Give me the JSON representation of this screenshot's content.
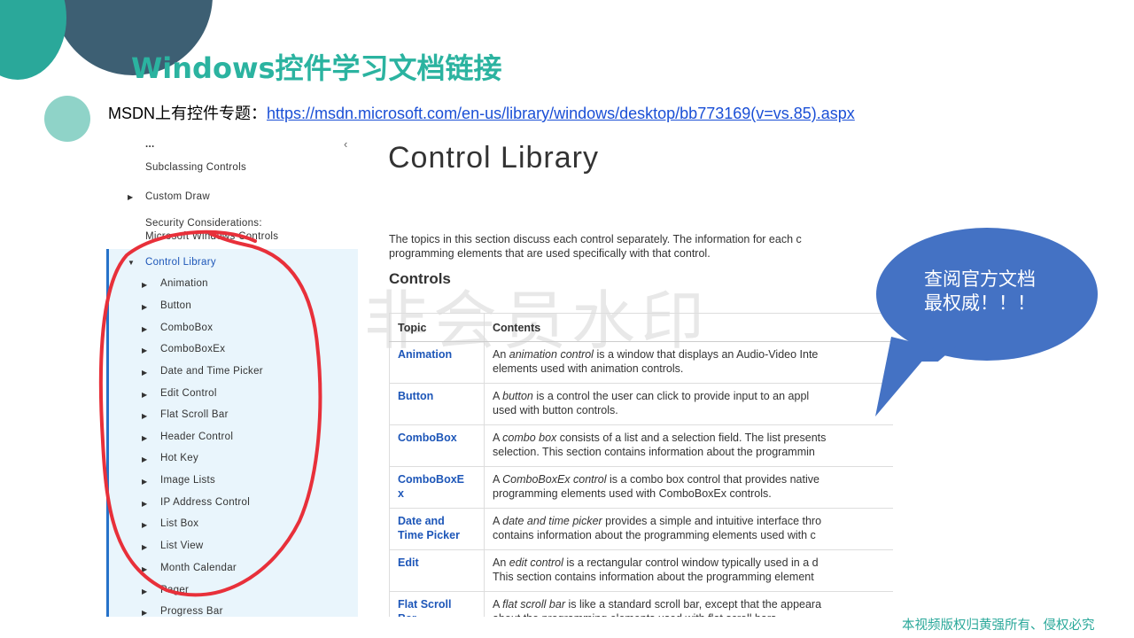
{
  "slide": {
    "title": "Windows控件学习文档链接",
    "msdn_prefix": "MSDN上有控件专题：",
    "msdn_link": "https://msdn.microsoft.com/en-us/library/windows/desktop/bb773169(v=vs.85).aspx",
    "footer": "本视频版权归黄强所有、侵权必究",
    "bubble_line1": "查阅官方文档",
    "bubble_line2": "最权威！！！",
    "colors": {
      "title": "#2bb3a0",
      "bubble": "#4472c4",
      "loop": "#e8303a",
      "link": "#1a4fd6"
    }
  },
  "sidebar": {
    "ellipsis": "...",
    "collapse_icon": "chevron-left-icon",
    "items": [
      {
        "label": "Subclassing Controls"
      },
      {
        "label": "Custom Draw"
      },
      {
        "label": "Security Considerations:"
      },
      {
        "label": "Microsoft Windows Controls"
      },
      {
        "label": "Control Library"
      },
      {
        "label": "Animation"
      },
      {
        "label": "Button"
      },
      {
        "label": "ComboBox"
      },
      {
        "label": "ComboBoxEx"
      },
      {
        "label": "Date and Time Picker"
      },
      {
        "label": "Edit Control"
      },
      {
        "label": "Flat Scroll Bar"
      },
      {
        "label": "Header Control"
      },
      {
        "label": "Hot Key"
      },
      {
        "label": "Image Lists"
      },
      {
        "label": "IP Address Control"
      },
      {
        "label": "List Box"
      },
      {
        "label": "List View"
      },
      {
        "label": "Month Calendar"
      },
      {
        "label": "Pager"
      },
      {
        "label": "Progress Bar"
      }
    ]
  },
  "content": {
    "heading": "Control Library",
    "intro_line1": "The topics in this section discuss each control separately. The information for each c",
    "intro_line2": "programming elements that are used specifically with that control.",
    "controls_heading": "Controls",
    "watermark": "非会员水印",
    "table": {
      "headers": [
        "Topic",
        "Contents"
      ],
      "rows": [
        {
          "topic1": "Animation",
          "topic2": "",
          "pre": "An ",
          "em": "animation control",
          "post": " is a window that displays an Audio-Video Inte",
          "line2": "elements used with animation controls."
        },
        {
          "topic1": "Button",
          "topic2": "",
          "pre": "A ",
          "em": "button",
          "post": " is a control the user can click to provide input to an appl",
          "line2": "used with button controls."
        },
        {
          "topic1": "ComboBox",
          "topic2": "",
          "pre": "A ",
          "em": "combo box",
          "post": " consists of a list and a selection field. The list presents",
          "line2": "selection. This section contains information about the programmin"
        },
        {
          "topic1": "ComboBoxE",
          "topic2": "x",
          "pre": "A ",
          "em": "ComboBoxEx control",
          "post": " is a combo box control that provides native",
          "line2": "programming elements used with ComboBoxEx controls."
        },
        {
          "topic1": "Date and",
          "topic2": "Time Picker",
          "pre": "A ",
          "em": "date and time picker",
          "post": " provides a simple and intuitive interface thro",
          "line2": "contains information about the programming elements used with c"
        },
        {
          "topic1": "Edit",
          "topic2": "",
          "pre": "An ",
          "em": "edit control",
          "post": " is a rectangular control window typically used in a d",
          "line2": "This section contains information about the programming element"
        },
        {
          "topic1": "Flat Scroll",
          "topic2": "Bar",
          "pre": "A ",
          "em": "flat scroll bar",
          "post": " is like a standard scroll bar, except that the appeara",
          "line2": "about the programming elements used with flat scroll bars."
        }
      ]
    }
  }
}
